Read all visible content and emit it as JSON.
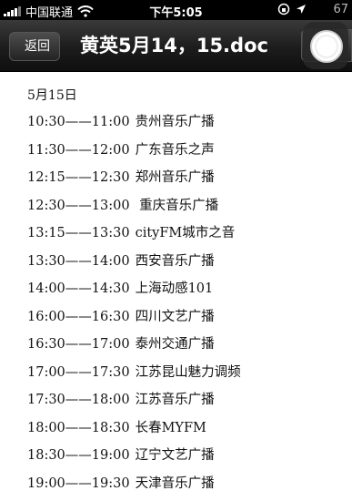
{
  "status_bar": {
    "carrier": "中国联通",
    "time": "下午5:05",
    "battery": "67"
  },
  "nav": {
    "back_label": "返回",
    "title": "黄英5月14，15.doc"
  },
  "document": {
    "date": "5月15日",
    "schedule": [
      {
        "slot": "10:30——11:00",
        "station": "贵州音乐广播"
      },
      {
        "slot": "11:30——12:00",
        "station": "广东音乐之声"
      },
      {
        "slot": "12:15——12:30",
        "station": "郑州音乐广播"
      },
      {
        "slot": "12:30——13:00",
        "station": " 重庆音乐广播"
      },
      {
        "slot": "13:15——13:30",
        "station": "cityFM城市之音"
      },
      {
        "slot": "13:30——14:00",
        "station": "西安音乐广播"
      },
      {
        "slot": "14:00——14:30",
        "station": "上海动感101"
      },
      {
        "slot": "16:00——16:30",
        "station": "四川文艺广播"
      },
      {
        "slot": "16:30——17:00",
        "station": "泰州交通广播"
      },
      {
        "slot": "17:00——17:30",
        "station": "江苏昆山魅力调频"
      },
      {
        "slot": "17:30——18:00",
        "station": "江苏音乐广播"
      },
      {
        "slot": "18:00——18:30",
        "station": "长春MYFM"
      },
      {
        "slot": "18:30——19:00",
        "station": "辽宁文艺广播"
      },
      {
        "slot": "19:00——19:30",
        "station": "天津音乐广播"
      }
    ]
  }
}
